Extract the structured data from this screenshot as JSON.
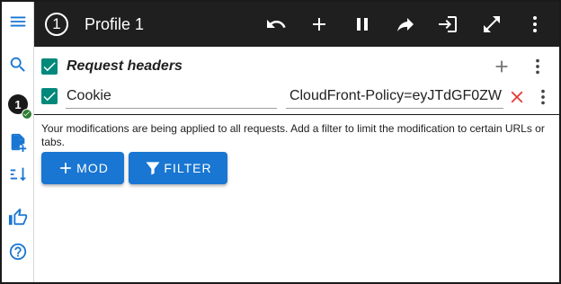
{
  "topbar": {
    "profile_number": "1",
    "profile_name": "Profile 1",
    "icons": [
      "undo-icon",
      "add-icon",
      "pause-icon",
      "redo-icon",
      "login-icon",
      "fullscreen-icon",
      "more-vert-icon"
    ]
  },
  "rail": {
    "icons": [
      "menu-icon",
      "search-icon",
      "profile-badge",
      "add-file-icon",
      "sort-icon",
      "thumb-up-icon",
      "help-icon"
    ],
    "profile_badge": "1"
  },
  "section": {
    "title": "Request headers",
    "checked": true
  },
  "header_row": {
    "checked": true,
    "name": "Cookie",
    "value": "CloudFront-Policy=eyJTdGF0ZW"
  },
  "notice": "Your modifications are being applied to all requests. Add a filter to limit the modification to certain URLs or tabs.",
  "buttons": {
    "mod_label": "MOD",
    "filter_label": "FILTER"
  },
  "colors": {
    "accent": "#1976d2",
    "checkbox": "#00897b",
    "topbar": "#1f1f1f",
    "delete": "#e53935",
    "status_ok": "#2e7d32"
  }
}
